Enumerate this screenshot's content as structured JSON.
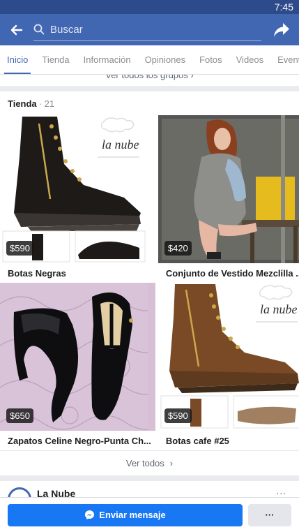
{
  "status_bar": {
    "time": "7:45"
  },
  "top_bar": {
    "search_placeholder": "Buscar"
  },
  "tabs": [
    {
      "label": "Inicio",
      "active": true
    },
    {
      "label": "Tienda"
    },
    {
      "label": "Información"
    },
    {
      "label": "Opiniones"
    },
    {
      "label": "Fotos"
    },
    {
      "label": "Videos"
    },
    {
      "label": "Event"
    }
  ],
  "groups_link": "Ver todos los grupos",
  "shop": {
    "title": "Tienda",
    "count": "· 21",
    "products": [
      {
        "name": "Botas Negras",
        "price": "$590",
        "brand_text": "la nube"
      },
      {
        "name": "Conjunto de  Vestido Mezclilla  ...",
        "price": "$420"
      },
      {
        "name": "Zapatos Celine Negro-Punta Ch...",
        "price": "$650"
      },
      {
        "name": "Botas cafe #25",
        "price": "$590",
        "brand_text": "la nube"
      }
    ],
    "see_all": "Ver todos"
  },
  "page_card": {
    "name": "La Nube",
    "more": "..."
  },
  "bottom_bar": {
    "message_label": "Enviar mensaje",
    "more_label": "···"
  },
  "colors": {
    "brand": "#4267b2",
    "status": "#2d4a8a",
    "button": "#1877f2"
  }
}
